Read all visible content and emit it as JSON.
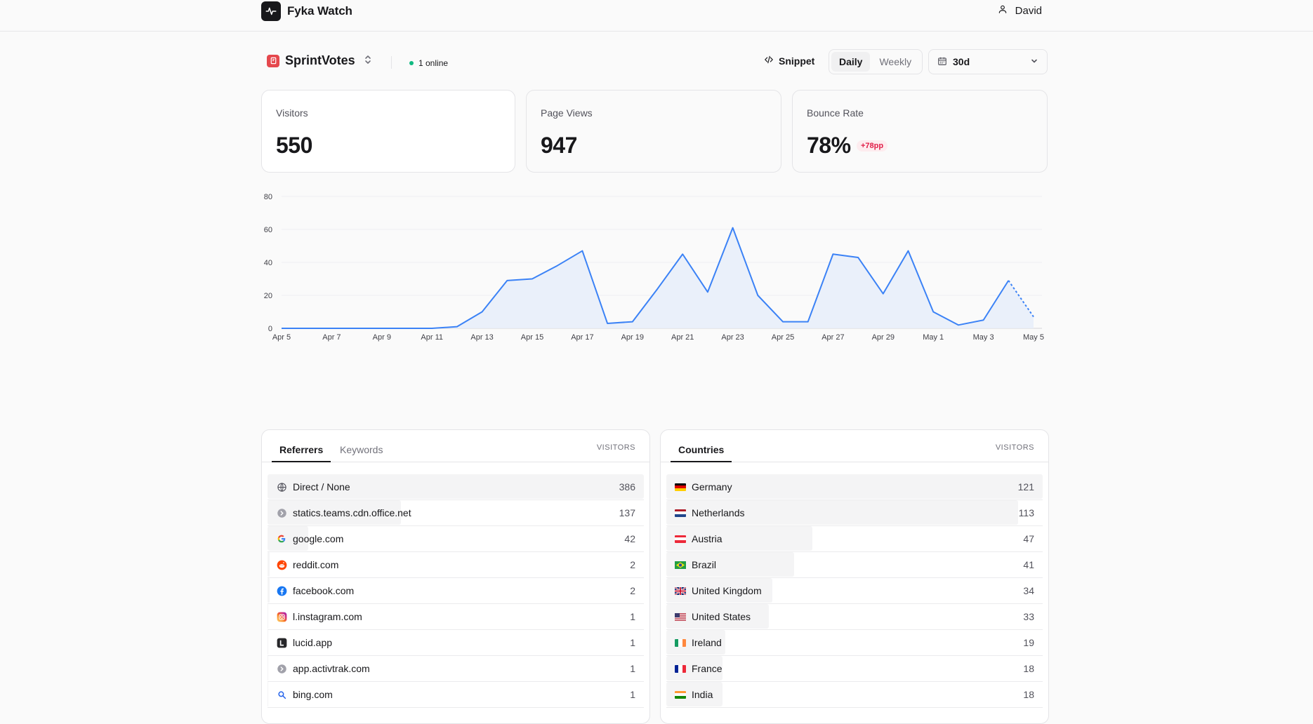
{
  "app": {
    "name": "Fyka Watch",
    "user": "David"
  },
  "project": {
    "name": "SprintVotes",
    "online": "1 online"
  },
  "toolbar": {
    "snippet": "Snippet",
    "daily": "Daily",
    "weekly": "Weekly",
    "range": "30d"
  },
  "stats": {
    "visitors": {
      "label": "Visitors",
      "value": "550"
    },
    "pageviews": {
      "label": "Page Views",
      "value": "947"
    },
    "bounce": {
      "label": "Bounce Rate",
      "value": "78%",
      "badge": "+78pp"
    }
  },
  "colors": {
    "accent": "#3b82f6",
    "area": "#e8eefa",
    "online": "#10b981",
    "badge_text": "#e11d48"
  },
  "chart_data": {
    "type": "area",
    "x": [
      "Apr 5",
      "Apr 6",
      "Apr 7",
      "Apr 8",
      "Apr 9",
      "Apr 10",
      "Apr 11",
      "Apr 12",
      "Apr 13",
      "Apr 14",
      "Apr 15",
      "Apr 16",
      "Apr 17",
      "Apr 18",
      "Apr 19",
      "Apr 20",
      "Apr 21",
      "Apr 22",
      "Apr 23",
      "Apr 24",
      "Apr 25",
      "Apr 26",
      "Apr 27",
      "Apr 28",
      "Apr 29",
      "Apr 30",
      "May 1",
      "May 2",
      "May 3",
      "May 4",
      "May 5"
    ],
    "values": [
      0,
      0,
      0,
      0,
      0,
      0,
      0,
      1,
      10,
      29,
      30,
      38,
      47,
      3,
      4,
      24,
      45,
      22,
      61,
      20,
      4,
      4,
      45,
      43,
      21,
      47,
      10,
      2,
      5,
      29,
      7
    ],
    "partial_last": true,
    "xticks": [
      "Apr 5",
      "Apr 7",
      "Apr 9",
      "Apr 11",
      "Apr 13",
      "Apr 15",
      "Apr 17",
      "Apr 19",
      "Apr 21",
      "Apr 23",
      "Apr 25",
      "Apr 27",
      "Apr 29",
      "May 1",
      "May 3",
      "May 5"
    ],
    "yticks": [
      0,
      20,
      40,
      60,
      80
    ],
    "ylim": [
      0,
      80
    ],
    "grid": true
  },
  "referrers": {
    "tabs": [
      "Referrers",
      "Keywords"
    ],
    "column": "VISITORS",
    "items": [
      {
        "label": "Direct / None",
        "count": "386",
        "value": 386,
        "icon": "globe-icon"
      },
      {
        "label": "statics.teams.cdn.office.net",
        "count": "137",
        "value": 137,
        "icon": "chevron-circle-icon"
      },
      {
        "label": "google.com",
        "count": "42",
        "value": 42,
        "icon": "google-icon"
      },
      {
        "label": "reddit.com",
        "count": "2",
        "value": 2,
        "icon": "reddit-icon"
      },
      {
        "label": "facebook.com",
        "count": "2",
        "value": 2,
        "icon": "facebook-icon"
      },
      {
        "label": "l.instagram.com",
        "count": "1",
        "value": 1,
        "icon": "instagram-icon"
      },
      {
        "label": "lucid.app",
        "count": "1",
        "value": 1,
        "icon": "lucid-icon"
      },
      {
        "label": "app.activtrak.com",
        "count": "1",
        "value": 1,
        "icon": "chevron-circle-icon"
      },
      {
        "label": "bing.com",
        "count": "1",
        "value": 1,
        "icon": "search-icon"
      }
    ]
  },
  "countries": {
    "tab": "Countries",
    "column": "VISITORS",
    "items": [
      {
        "label": "Germany",
        "count": "121",
        "value": 121,
        "flag": "de"
      },
      {
        "label": "Netherlands",
        "count": "113",
        "value": 113,
        "flag": "nl"
      },
      {
        "label": "Austria",
        "count": "47",
        "value": 47,
        "flag": "at"
      },
      {
        "label": "Brazil",
        "count": "41",
        "value": 41,
        "flag": "br"
      },
      {
        "label": "United Kingdom",
        "count": "34",
        "value": 34,
        "flag": "gb"
      },
      {
        "label": "United States",
        "count": "33",
        "value": 33,
        "flag": "us"
      },
      {
        "label": "Ireland",
        "count": "19",
        "value": 19,
        "flag": "ie"
      },
      {
        "label": "France",
        "count": "18",
        "value": 18,
        "flag": "fr"
      },
      {
        "label": "India",
        "count": "18",
        "value": 18,
        "flag": "in"
      }
    ]
  }
}
